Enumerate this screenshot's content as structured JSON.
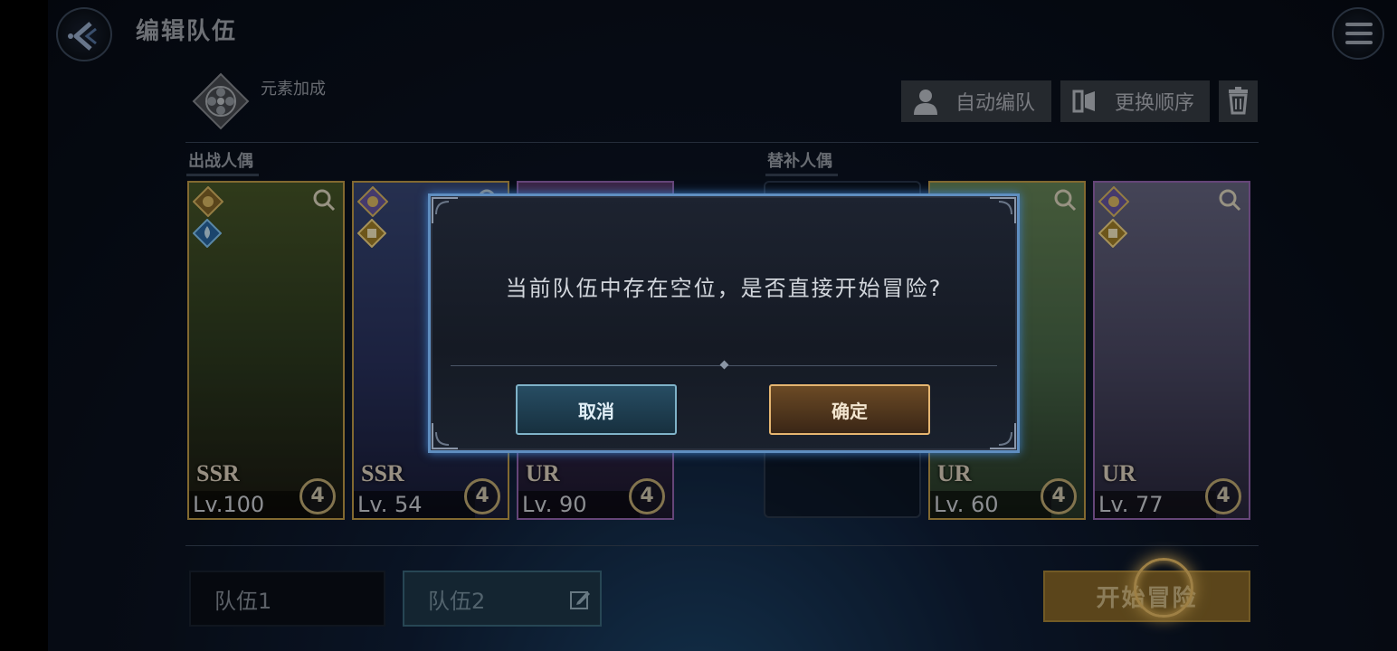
{
  "header": {
    "title": "编辑队伍",
    "back_icon": "back-arrow-icon",
    "menu_icon": "hamburger-menu-icon"
  },
  "element_bonus": {
    "label": "元素加成",
    "icon": "element-emblem-icon"
  },
  "toolbar": {
    "auto_team_label": "自动编队",
    "reorder_label": "更换顺序",
    "delete_icon": "trash-icon"
  },
  "sections": {
    "active_label": "出战人偶",
    "reserve_label": "替补人偶"
  },
  "active_cards": [
    {
      "rarity": "SSR",
      "level": "Lv.100",
      "emblem": "4",
      "frame": "#c8a24a",
      "bg": [
        "#4a5a2a",
        "#2d3a20",
        "#1c1a12"
      ]
    },
    {
      "rarity": "SSR",
      "level": "Lv. 54",
      "emblem": "4",
      "frame": "#c8a24a",
      "bg": [
        "#3a4a7a",
        "#2a3360",
        "#1a1d38"
      ]
    },
    {
      "rarity": "UR",
      "level": "Lv. 90",
      "emblem": "4",
      "frame": "#9b6ab8",
      "bg": [
        "#5a3a6a",
        "#3a2a52",
        "#1e1a30"
      ]
    }
  ],
  "reserve_cards": [
    {
      "rarity": "UR",
      "level": "Lv. 60",
      "emblem": "4",
      "frame": "#c8a24a",
      "bg": [
        "#6a8a5a",
        "#4a6a4a",
        "#2a3a2a"
      ]
    },
    {
      "rarity": "UR",
      "level": "Lv. 77",
      "emblem": "4",
      "frame": "#9b6ab8",
      "bg": [
        "#6a6a86",
        "#4c4a66",
        "#2a283e"
      ]
    }
  ],
  "teams": {
    "team1_label": "队伍1",
    "team2_label": "队伍2",
    "edit_icon": "edit-icon"
  },
  "start_button": {
    "label": "开始冒险"
  },
  "dialog": {
    "message": "当前队伍中存在空位，是否直接开始冒险?",
    "cancel_label": "取消",
    "confirm_label": "确定"
  },
  "colors": {
    "dialog_border": "#5f8ec0",
    "cancel_border": "#7fb2c8",
    "confirm_border": "#e5b570",
    "start_button": "#8c6b2a"
  }
}
